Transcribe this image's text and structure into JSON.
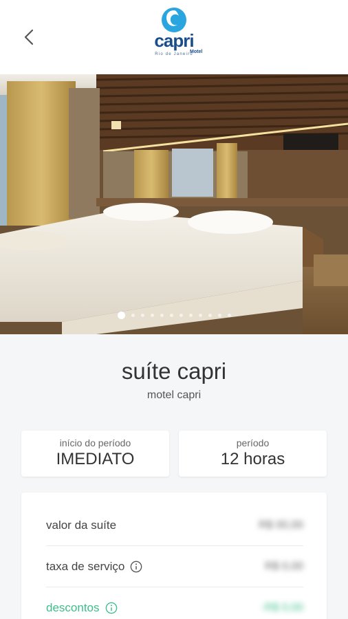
{
  "header": {
    "back_label": "voltar",
    "logo": {
      "brand": "capri",
      "sub": "Motel",
      "city": "Rio de Janeiro"
    }
  },
  "gallery": {
    "total": 12,
    "active": 0
  },
  "suite": {
    "name": "suíte capri",
    "motel": "motel capri"
  },
  "booking": {
    "start_label": "início do período",
    "start_value": "IMEDIATO",
    "period_label": "período",
    "period_value": "12 horas"
  },
  "prices": [
    {
      "label": "valor da suíte",
      "value": "R$ 00,00",
      "info": false,
      "accent": false
    },
    {
      "label": "taxa de serviço",
      "value": "R$ 0,00",
      "info": true,
      "accent": false
    },
    {
      "label": "descontos",
      "value": "-R$ 0,00",
      "info": true,
      "accent": true
    }
  ],
  "colors": {
    "brand": "#1a4d8c",
    "accent": "#3dbf8a",
    "background": "#f5f6f8"
  }
}
